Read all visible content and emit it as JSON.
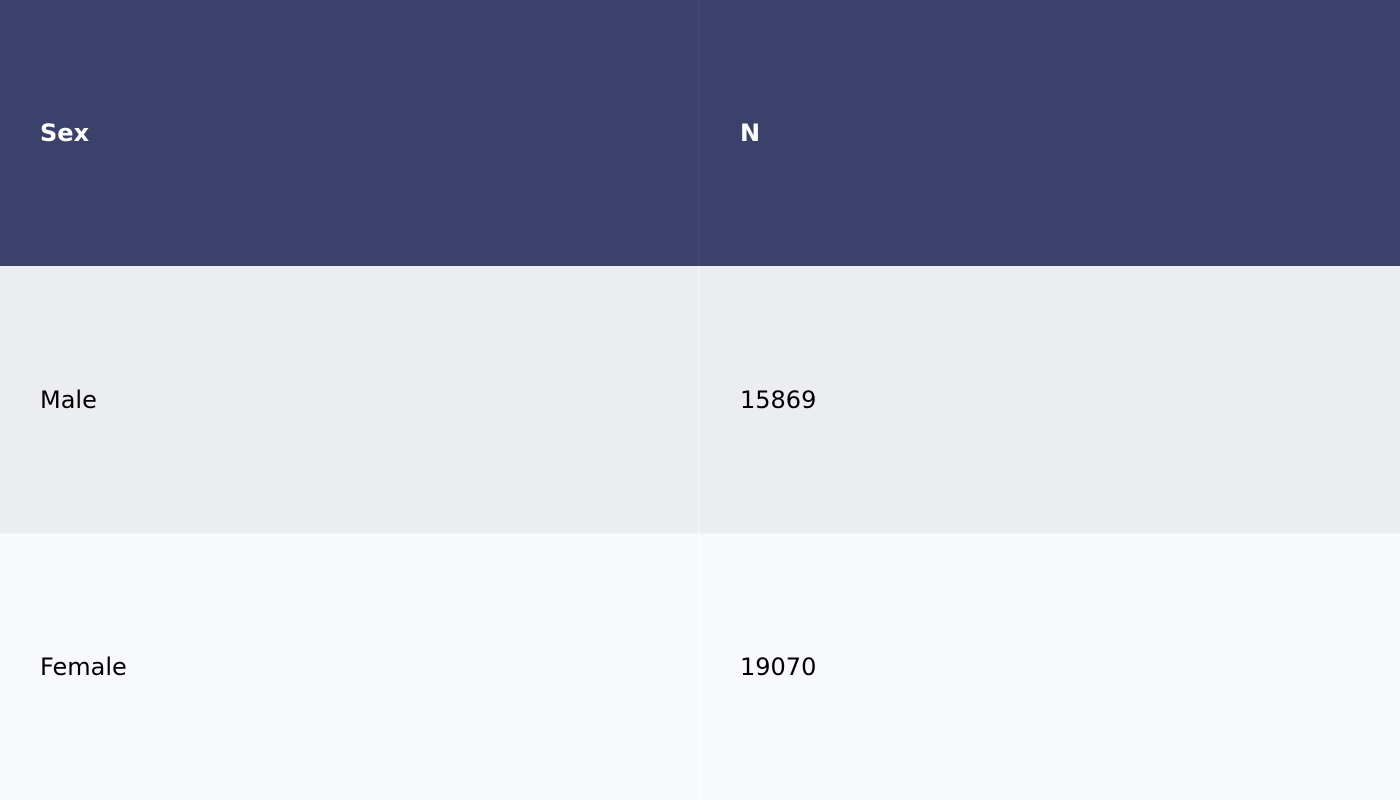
{
  "chart_data": {
    "type": "table",
    "columns": [
      "Sex",
      "N"
    ],
    "rows": [
      [
        "Male",
        "15869"
      ],
      [
        "Female",
        "19070"
      ]
    ]
  },
  "colors": {
    "header_bg": "#3b416b",
    "header_text": "#ffffff",
    "row_odd_bg": "#ecedf1",
    "row_even_bg": "#f8f9fc"
  }
}
